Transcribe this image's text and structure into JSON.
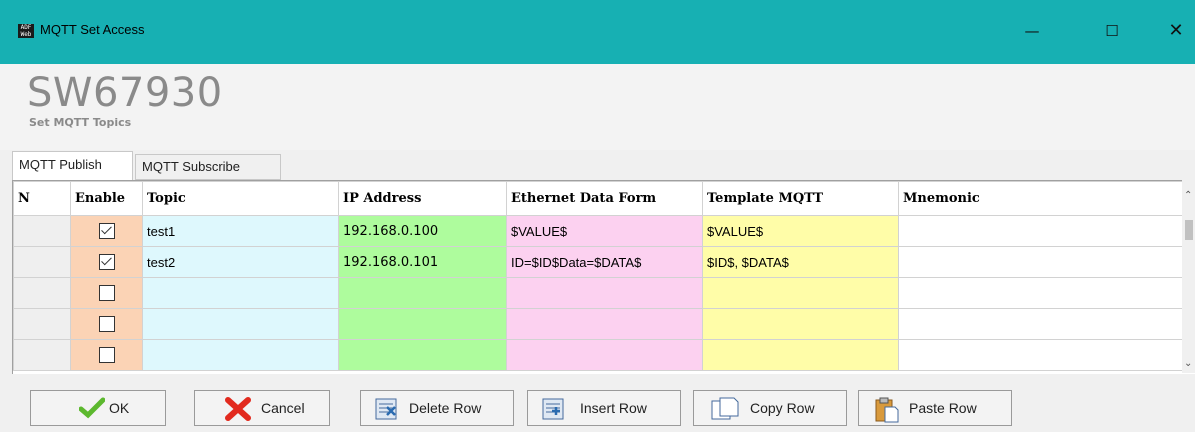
{
  "window": {
    "title": "MQTT Set Access",
    "app_icon_text": "ADF Web"
  },
  "header": {
    "product": "SW67930",
    "subtitle": "Set MQTT Topics"
  },
  "tabs": [
    {
      "label": "MQTT Publish",
      "active": true
    },
    {
      "label": "MQTT Subscribe",
      "active": false
    }
  ],
  "grid": {
    "columns": [
      "N",
      "Enable",
      "Topic",
      "IP Address",
      "Ethernet Data Form",
      "Template MQTT",
      "Mnemonic"
    ],
    "rows": [
      {
        "n": "",
        "enable": true,
        "topic": "test1",
        "ip": "192.168.0.100",
        "eth": "$VALUE$",
        "tmpl": "$VALUE$",
        "mnem": ""
      },
      {
        "n": "",
        "enable": true,
        "topic": "test2",
        "ip": "192.168.0.101",
        "eth": "ID=$ID$Data=$DATA$",
        "tmpl": "$ID$, $DATA$",
        "mnem": ""
      },
      {
        "n": "",
        "enable": false,
        "topic": "",
        "ip": "",
        "eth": "",
        "tmpl": "",
        "mnem": ""
      },
      {
        "n": "",
        "enable": false,
        "topic": "",
        "ip": "",
        "eth": "",
        "tmpl": "",
        "mnem": ""
      },
      {
        "n": "",
        "enable": false,
        "topic": "",
        "ip": "",
        "eth": "",
        "tmpl": "",
        "mnem": ""
      }
    ]
  },
  "buttons": {
    "ok": "OK",
    "cancel": "Cancel",
    "delete_row": "Delete Row",
    "insert_row": "Insert Row",
    "copy_row": "Copy Row",
    "paste_row": "Paste Row"
  },
  "colors": {
    "titlebar": "#17b0b3",
    "enable": "#fbd3b5",
    "topic": "#def8fd",
    "ip": "#aefc9d",
    "eth": "#fcd1f0",
    "template": "#fffda8"
  }
}
